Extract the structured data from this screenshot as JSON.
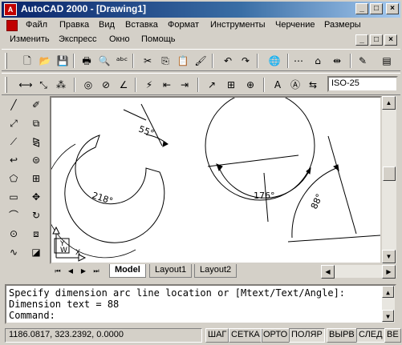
{
  "window": {
    "title": "AutoCAD 2000 - [Drawing1]",
    "app_icon": "A",
    "minimize": "_",
    "maximize": "□",
    "close": "×"
  },
  "menu": {
    "row1": [
      "Файл",
      "Правка",
      "Вид",
      "Вставка",
      "Формат",
      "Инструменты",
      "Черчение",
      "Размеры"
    ],
    "row2": [
      "Изменить",
      "Экспресс",
      "Окно",
      "Помощь"
    ]
  },
  "toolbar": {
    "dimstyle": "ISO-25"
  },
  "drawing": {
    "dim1": "218°",
    "dim2": "55°",
    "dim3": "176°",
    "dim4": "88°",
    "ucs_x": "X",
    "ucs_y": "Y",
    "ucs_w": "W"
  },
  "tabs": [
    "Model",
    "Layout1",
    "Layout2"
  ],
  "command": {
    "line1": "Specify dimension arc line location or [Mtext/Text/Angle]:",
    "line2": "Dimension text = 88",
    "line3": "Command:"
  },
  "status": {
    "coords": "1186.0817, 323.2392, 0.0000",
    "buttons": [
      "ШАГ",
      "СЕТКА",
      "ОРТО",
      "ПОЛЯР",
      "ВЫРВ",
      "СЛЕД",
      "ВЕ"
    ]
  },
  "icons": {
    "standard": [
      "new-icon",
      "open-icon",
      "save-icon",
      "print-icon",
      "preview-icon",
      "spell-icon",
      "cut-icon",
      "copy-icon",
      "paste-icon",
      "matchprop-icon",
      "undo-icon",
      "redo-icon",
      "web-icon",
      "hyperlink-icon",
      "tracking-icon",
      "point-icon",
      "pencil-icon",
      "properties-icon"
    ],
    "dimension": [
      "dim-linear-icon",
      "dim-aligned-icon",
      "dim-ordinate-icon",
      "dim-radius-icon",
      "dim-diameter-icon",
      "dim-angular-icon",
      "dim-quick-icon",
      "dim-baseline-icon",
      "dim-continue-icon",
      "leader-icon",
      "tolerance-icon",
      "center-mark-icon",
      "dim-edit-icon",
      "dim-text-edit-icon",
      "dim-update-icon"
    ],
    "draw": [
      "line-icon",
      "construction-line-icon",
      "polyline-icon",
      "polygon-icon",
      "rectangle-icon",
      "arc-icon",
      "circle-icon",
      "spline-icon",
      "ellipse-icon"
    ],
    "modify": [
      "erase-icon",
      "copy-object-icon",
      "mirror-icon",
      "offset-icon",
      "array-icon",
      "move-icon",
      "rotate-icon",
      "scale-icon",
      "stretch-icon"
    ]
  }
}
